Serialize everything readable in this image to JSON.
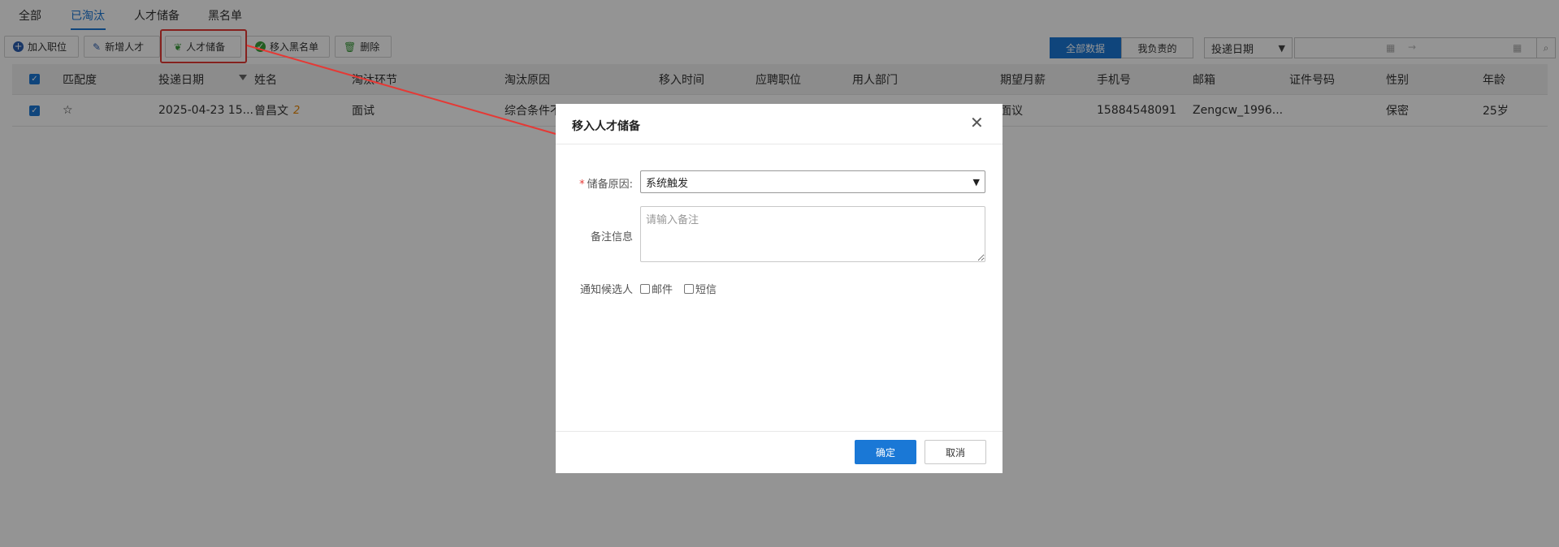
{
  "tabs": [
    {
      "label": "全部"
    },
    {
      "label": "已淘汰"
    },
    {
      "label": "人才储备"
    },
    {
      "label": "黑名单"
    }
  ],
  "toolbar": {
    "add_position": "加入职位",
    "new_talent": "新增人才",
    "talent_reserve": "人才储备",
    "move_blacklist": "移入黑名单",
    "delete": "删除"
  },
  "filters": {
    "all_data": "全部数据",
    "mine": "我负责的",
    "date_type": "投递日期"
  },
  "table": {
    "headers": [
      "匹配度",
      "投递日期",
      "姓名",
      "淘汰环节",
      "淘汰原因",
      "移入时间",
      "应聘职位",
      "用人部门",
      "期望月薪",
      "手机号",
      "邮箱",
      "证件号码",
      "性别",
      "年龄"
    ],
    "row": {
      "match": "☆",
      "date": "2025-04-23 15...",
      "name": "曾昌文",
      "name_badge": "2",
      "stage": "面试",
      "reason": "综合条件不",
      "salary": "面议",
      "phone": "15884548091",
      "email": "Zengcw_1996...",
      "gender": "保密",
      "age": "25岁"
    }
  },
  "modal": {
    "title": "移入人才储备",
    "reason_label": "储备原因:",
    "reason_required": "*",
    "reason_value": "系统触发",
    "remark_label": "备注信息",
    "remark_placeholder": "请输入备注",
    "notify_label": "通知候选人",
    "notify_email": "邮件",
    "notify_sms": "短信",
    "ok": "确定",
    "cancel": "取消"
  },
  "colors": {
    "accent": "#1a78d6",
    "annotation": "#e53935"
  }
}
